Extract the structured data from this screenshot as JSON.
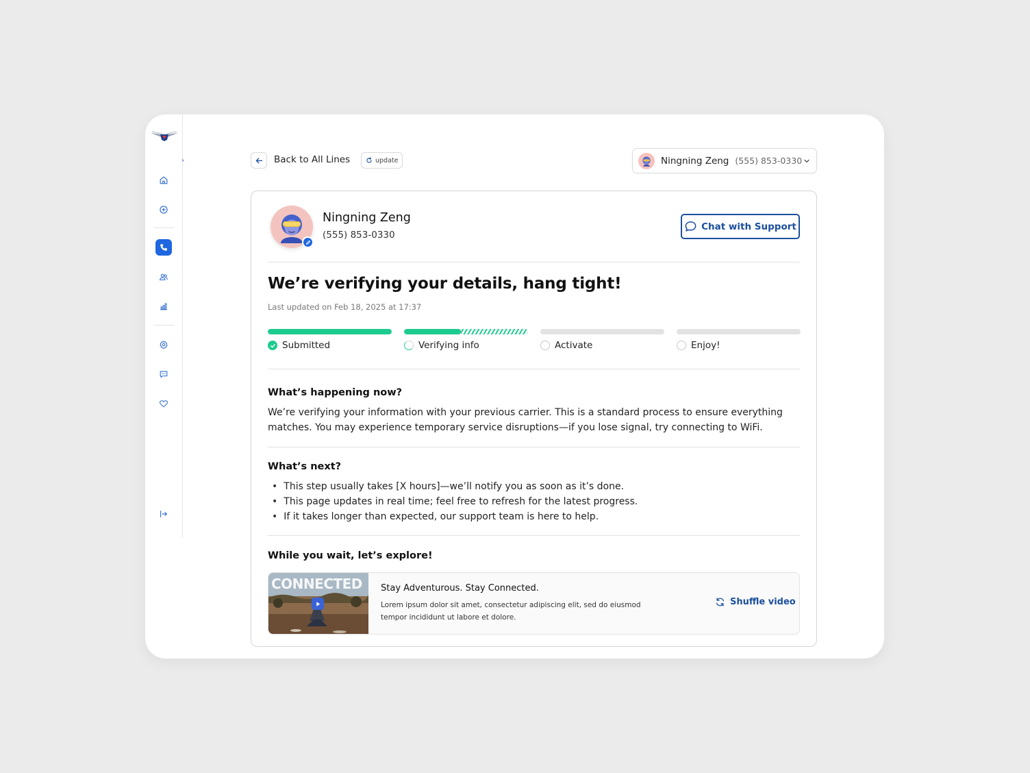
{
  "colors": {
    "accent_blue": "#1f67e0",
    "brand_navy": "#1b4f9c",
    "progress_green": "#1ecb8e",
    "track_gray": "#e3e3e3",
    "background": "#ebebeb"
  },
  "sidebar": {
    "logo": "winged-logo",
    "collapse_icon": "chevron-right-icon",
    "items": [
      {
        "name": "home",
        "icon": "home-icon",
        "active": false
      },
      {
        "name": "add",
        "icon": "plus-circle-icon",
        "active": false
      },
      {
        "name": "lines",
        "icon": "phone-icon",
        "active": true
      },
      {
        "name": "people",
        "icon": "users-icon",
        "active": false
      },
      {
        "name": "usage",
        "icon": "bar-chart-icon",
        "active": false
      },
      {
        "name": "settings",
        "icon": "gear-icon",
        "active": false
      },
      {
        "name": "messages",
        "icon": "chat-icon",
        "active": false
      },
      {
        "name": "favorites",
        "icon": "heart-icon",
        "active": false
      },
      {
        "name": "logout",
        "icon": "logout-icon",
        "active": false
      }
    ]
  },
  "topbar": {
    "back_label": "Back to All Lines",
    "update_label": "update",
    "account": {
      "name": "Ningning Zeng",
      "phone": "(555) 853-0330"
    }
  },
  "profile": {
    "name": "Ningning Zeng",
    "phone": "(555) 853-0330",
    "chat_label": "Chat with Support"
  },
  "status": {
    "headline": "We’re verifying your details, hang tight!",
    "last_updated": "Last updated on Feb 18, 2025 at 17:37",
    "steps": [
      {
        "label": "Submitted",
        "state": "done",
        "progress": 1.0
      },
      {
        "label": "Verifying info",
        "state": "in-progress",
        "progress": 0.46
      },
      {
        "label": "Activate",
        "state": "pending",
        "progress": 0
      },
      {
        "label": "Enjoy!",
        "state": "pending",
        "progress": 0
      }
    ]
  },
  "happening": {
    "title": "What’s happening now?",
    "body": "We’re verifying your information with your previous carrier. This is a standard process to ensure everything matches. You may experience temporary service disruptions—if you lose signal, try connecting to WiFi."
  },
  "next": {
    "title": "What’s next?",
    "items": [
      "This step usually takes [X hours]—we’ll notify you as soon as it’s done.",
      "This page updates in real time; feel free to refresh for the latest progress.",
      "If it takes longer than expected, our support team is here to help."
    ]
  },
  "explore": {
    "title": "While you wait, let’s explore!",
    "video": {
      "thumbnail_text": "CONNECTED",
      "title": "Stay Adventurous. Stay Connected.",
      "description": "Lorem ipsum dolor sit amet, consectetur adipiscing elit, sed do eiusmod tempor incididunt ut labore et dolore."
    },
    "shuffle_label": "Shuffle video"
  }
}
